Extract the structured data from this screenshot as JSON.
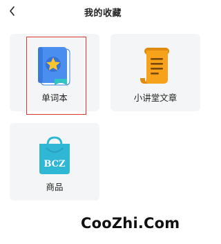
{
  "header": {
    "title": "我的收藏",
    "back_icon": "chevron-left-icon"
  },
  "cards": [
    {
      "label": "单词本",
      "icon": "wordbook-icon",
      "highlighted": true
    },
    {
      "label": "小讲堂文章",
      "icon": "scroll-article-icon",
      "highlighted": false
    },
    {
      "label": "商品",
      "icon": "shopping-bag-icon",
      "badge_text": "BCZ",
      "highlighted": false
    }
  ],
  "watermark": "CooZhi.Com",
  "colors": {
    "card_bg": "#f4f5f6",
    "highlight": "#d73b34",
    "book_blue": "#4a8ef0",
    "star_yellow": "#f7c52c",
    "scroll_orange": "#f7a21b",
    "bag_teal": "#31b7d6"
  }
}
